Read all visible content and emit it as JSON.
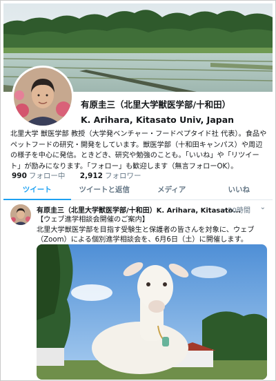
{
  "profile": {
    "name": "有原圭三（北里大学獣医学部/十和田）",
    "name_en": "K. Arihara, Kitasato Univ, Japan",
    "bio": "北里大学 獣医学部 教授（大学発ベンチャー・フードペプタイド社 代表）。食品やペットフードの研究・開発をしています。獣医学部（十和田キャンパス）や周辺の様子を中心に発信。ときどき、研究や勉強のことも。「いいね」や「リツイート」が励みになります。「フォロー」も歓迎します（無言フォローOK）。",
    "following_count": "990",
    "following_label": "フォロー中",
    "followers_count": "2,912",
    "followers_label": "フォロワー"
  },
  "tabs": [
    "ツイート",
    "ツイートと返信",
    "メディア",
    "いいね"
  ],
  "tweet": {
    "author": "有原圭三（北里大学獣医学部/十和田）K. Arihara, Kitasato...",
    "time": "・20時間",
    "caret": "⌄",
    "line1": "【ウェブ進学相談会開催のご案内】",
    "line2": "北里大学獣医学部を目指す受験生と保護者の皆さんを対象に、ウェブ（Zoom）による個別進学相談会を、6月6日（土）に開催します。"
  },
  "colors": {
    "accent": "#1da1f2",
    "muted": "#657786",
    "text": "#14171a"
  }
}
